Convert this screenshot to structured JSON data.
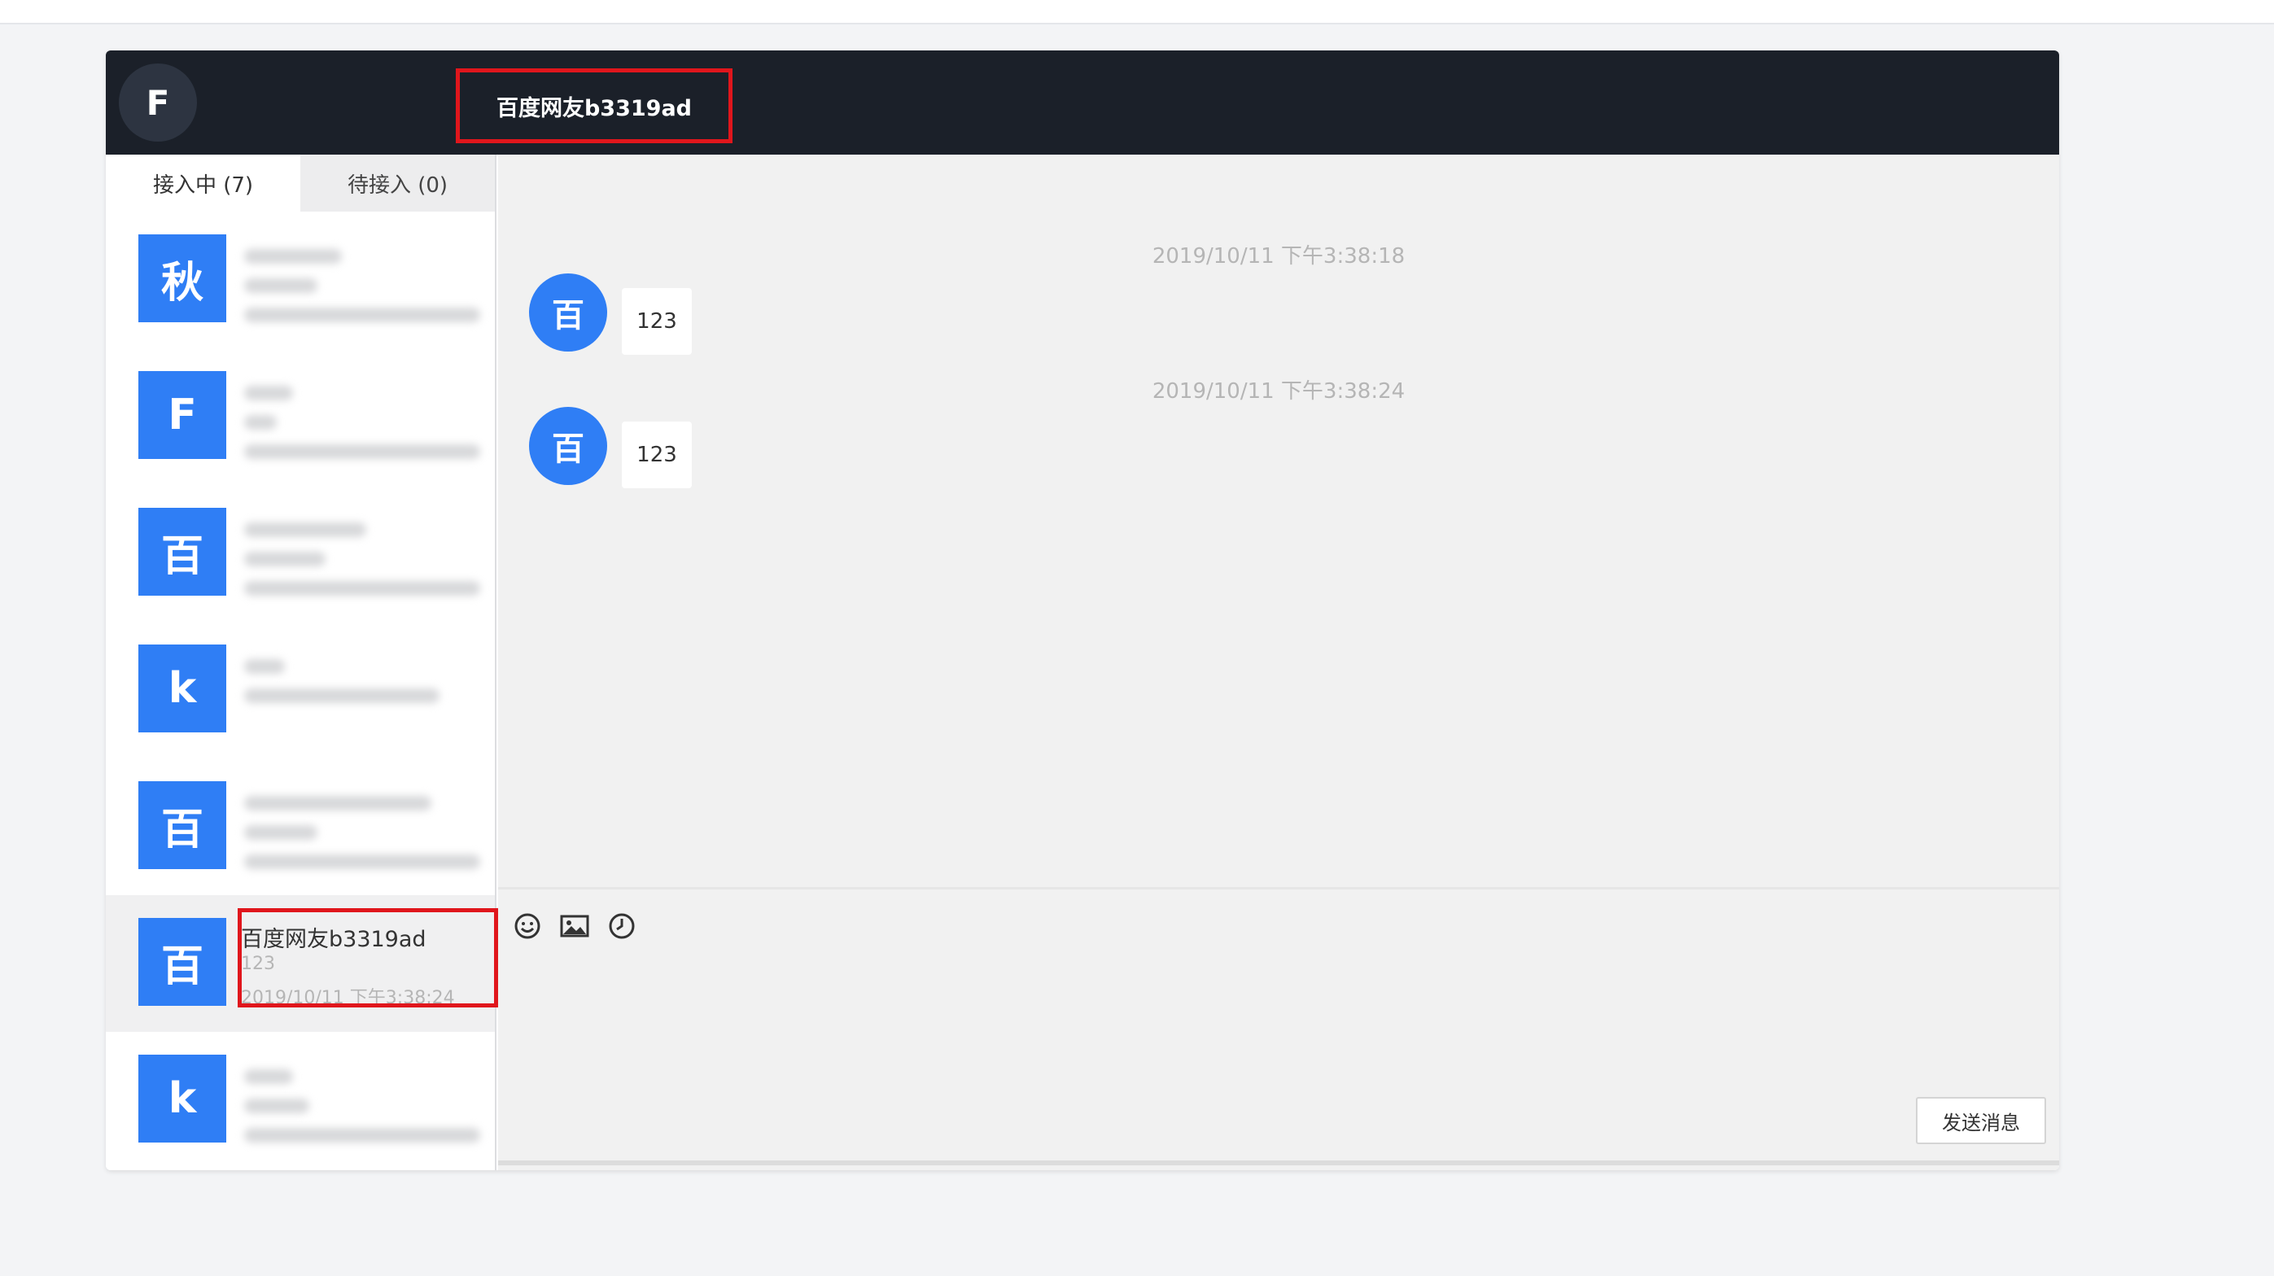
{
  "header": {
    "avatar_letter": "F",
    "title": "百度网友b3319ad"
  },
  "tabs": [
    {
      "label": "接入中 (7)"
    },
    {
      "label": "待接入 (0)"
    }
  ],
  "conversations": [
    {
      "avatar": "秋"
    },
    {
      "avatar": "F"
    },
    {
      "avatar": "百"
    },
    {
      "avatar": "k"
    },
    {
      "avatar": "百"
    },
    {
      "avatar": "百",
      "name": "百度网友b3319ad",
      "last_message": "123",
      "time": "2019/10/11 下午3:38:24"
    },
    {
      "avatar": "k"
    }
  ],
  "messages": [
    {
      "timestamp": "2019/10/11 下午3:38:18",
      "avatar": "百",
      "text": "123"
    },
    {
      "timestamp": "2019/10/11 下午3:38:24",
      "avatar": "百",
      "text": "123"
    }
  ],
  "toolbar": {
    "icons": [
      "smiley-icon",
      "image-icon",
      "clock-icon"
    ]
  },
  "send_button": "发送消息",
  "colors": {
    "header_bg": "#1b2029",
    "accent_blue": "#2f7ef5",
    "highlight_red": "#e0161c"
  }
}
